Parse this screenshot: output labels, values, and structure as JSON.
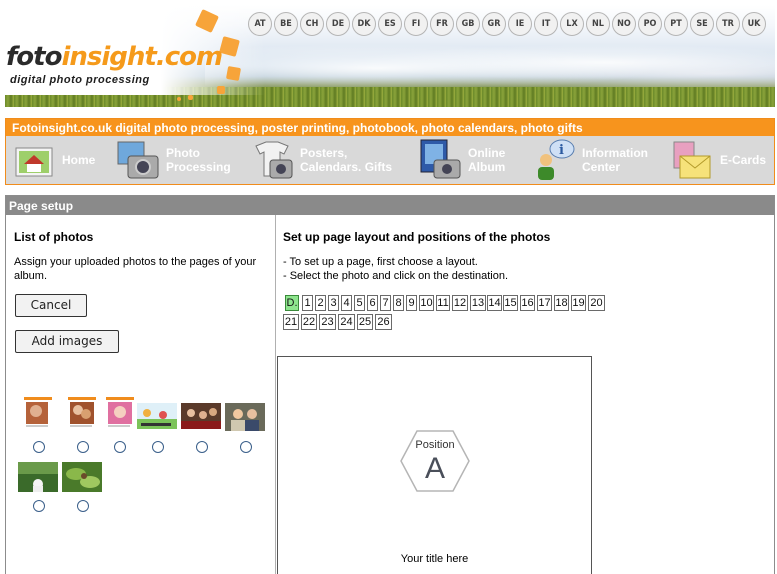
{
  "brand": {
    "logo_part1": "foto",
    "logo_part2": "insight",
    "logo_part3": ".com",
    "tagline": "digital photo processing"
  },
  "countries": [
    "AT",
    "BE",
    "CH",
    "DE",
    "DK",
    "ES",
    "FI",
    "FR",
    "GB",
    "GR",
    "IE",
    "IT",
    "LX",
    "NL",
    "NO",
    "PO",
    "PT",
    "SE",
    "TR",
    "UK"
  ],
  "nav": {
    "title": "Fotoinsight.co.uk digital photo processing, poster printing, photobook, photo calendars, photo gifts",
    "items": [
      {
        "line1": "Home",
        "line2": ""
      },
      {
        "line1": "Photo",
        "line2": "Processing"
      },
      {
        "line1": "Posters,",
        "line2": "Calendars. Gifts"
      },
      {
        "line1": "Online",
        "line2": "Album"
      },
      {
        "line1": "Information",
        "line2": "Center"
      },
      {
        "line1": "E-Cards",
        "line2": ""
      }
    ]
  },
  "panel": {
    "title": "Page setup",
    "left": {
      "heading": "List of photos",
      "description": "Assign your uploaded photos to the pages of your album.",
      "cancel": "Cancel",
      "add_images": "Add images"
    },
    "right": {
      "heading": "Set up page layout and positions of the photos",
      "instruction1": "- To set up a page, first choose a layout.",
      "instruction2": "- Select the photo and click on the destination.",
      "pages": [
        "D.",
        "1",
        "2",
        "3",
        "4",
        "5",
        "6",
        "7",
        "8",
        "9",
        "10",
        "11",
        "12",
        "13",
        "14",
        "15",
        "16",
        "17",
        "18",
        "19",
        "20",
        "21",
        "22",
        "23",
        "24",
        "25",
        "26"
      ],
      "selected_page": "D.",
      "position_label": "Position",
      "position_letter": "A",
      "caption": "Your title here"
    }
  },
  "colors": {
    "accent": "#f7941d",
    "panel_header": "#8a8a8a",
    "selected_page": "#8ee58e"
  }
}
